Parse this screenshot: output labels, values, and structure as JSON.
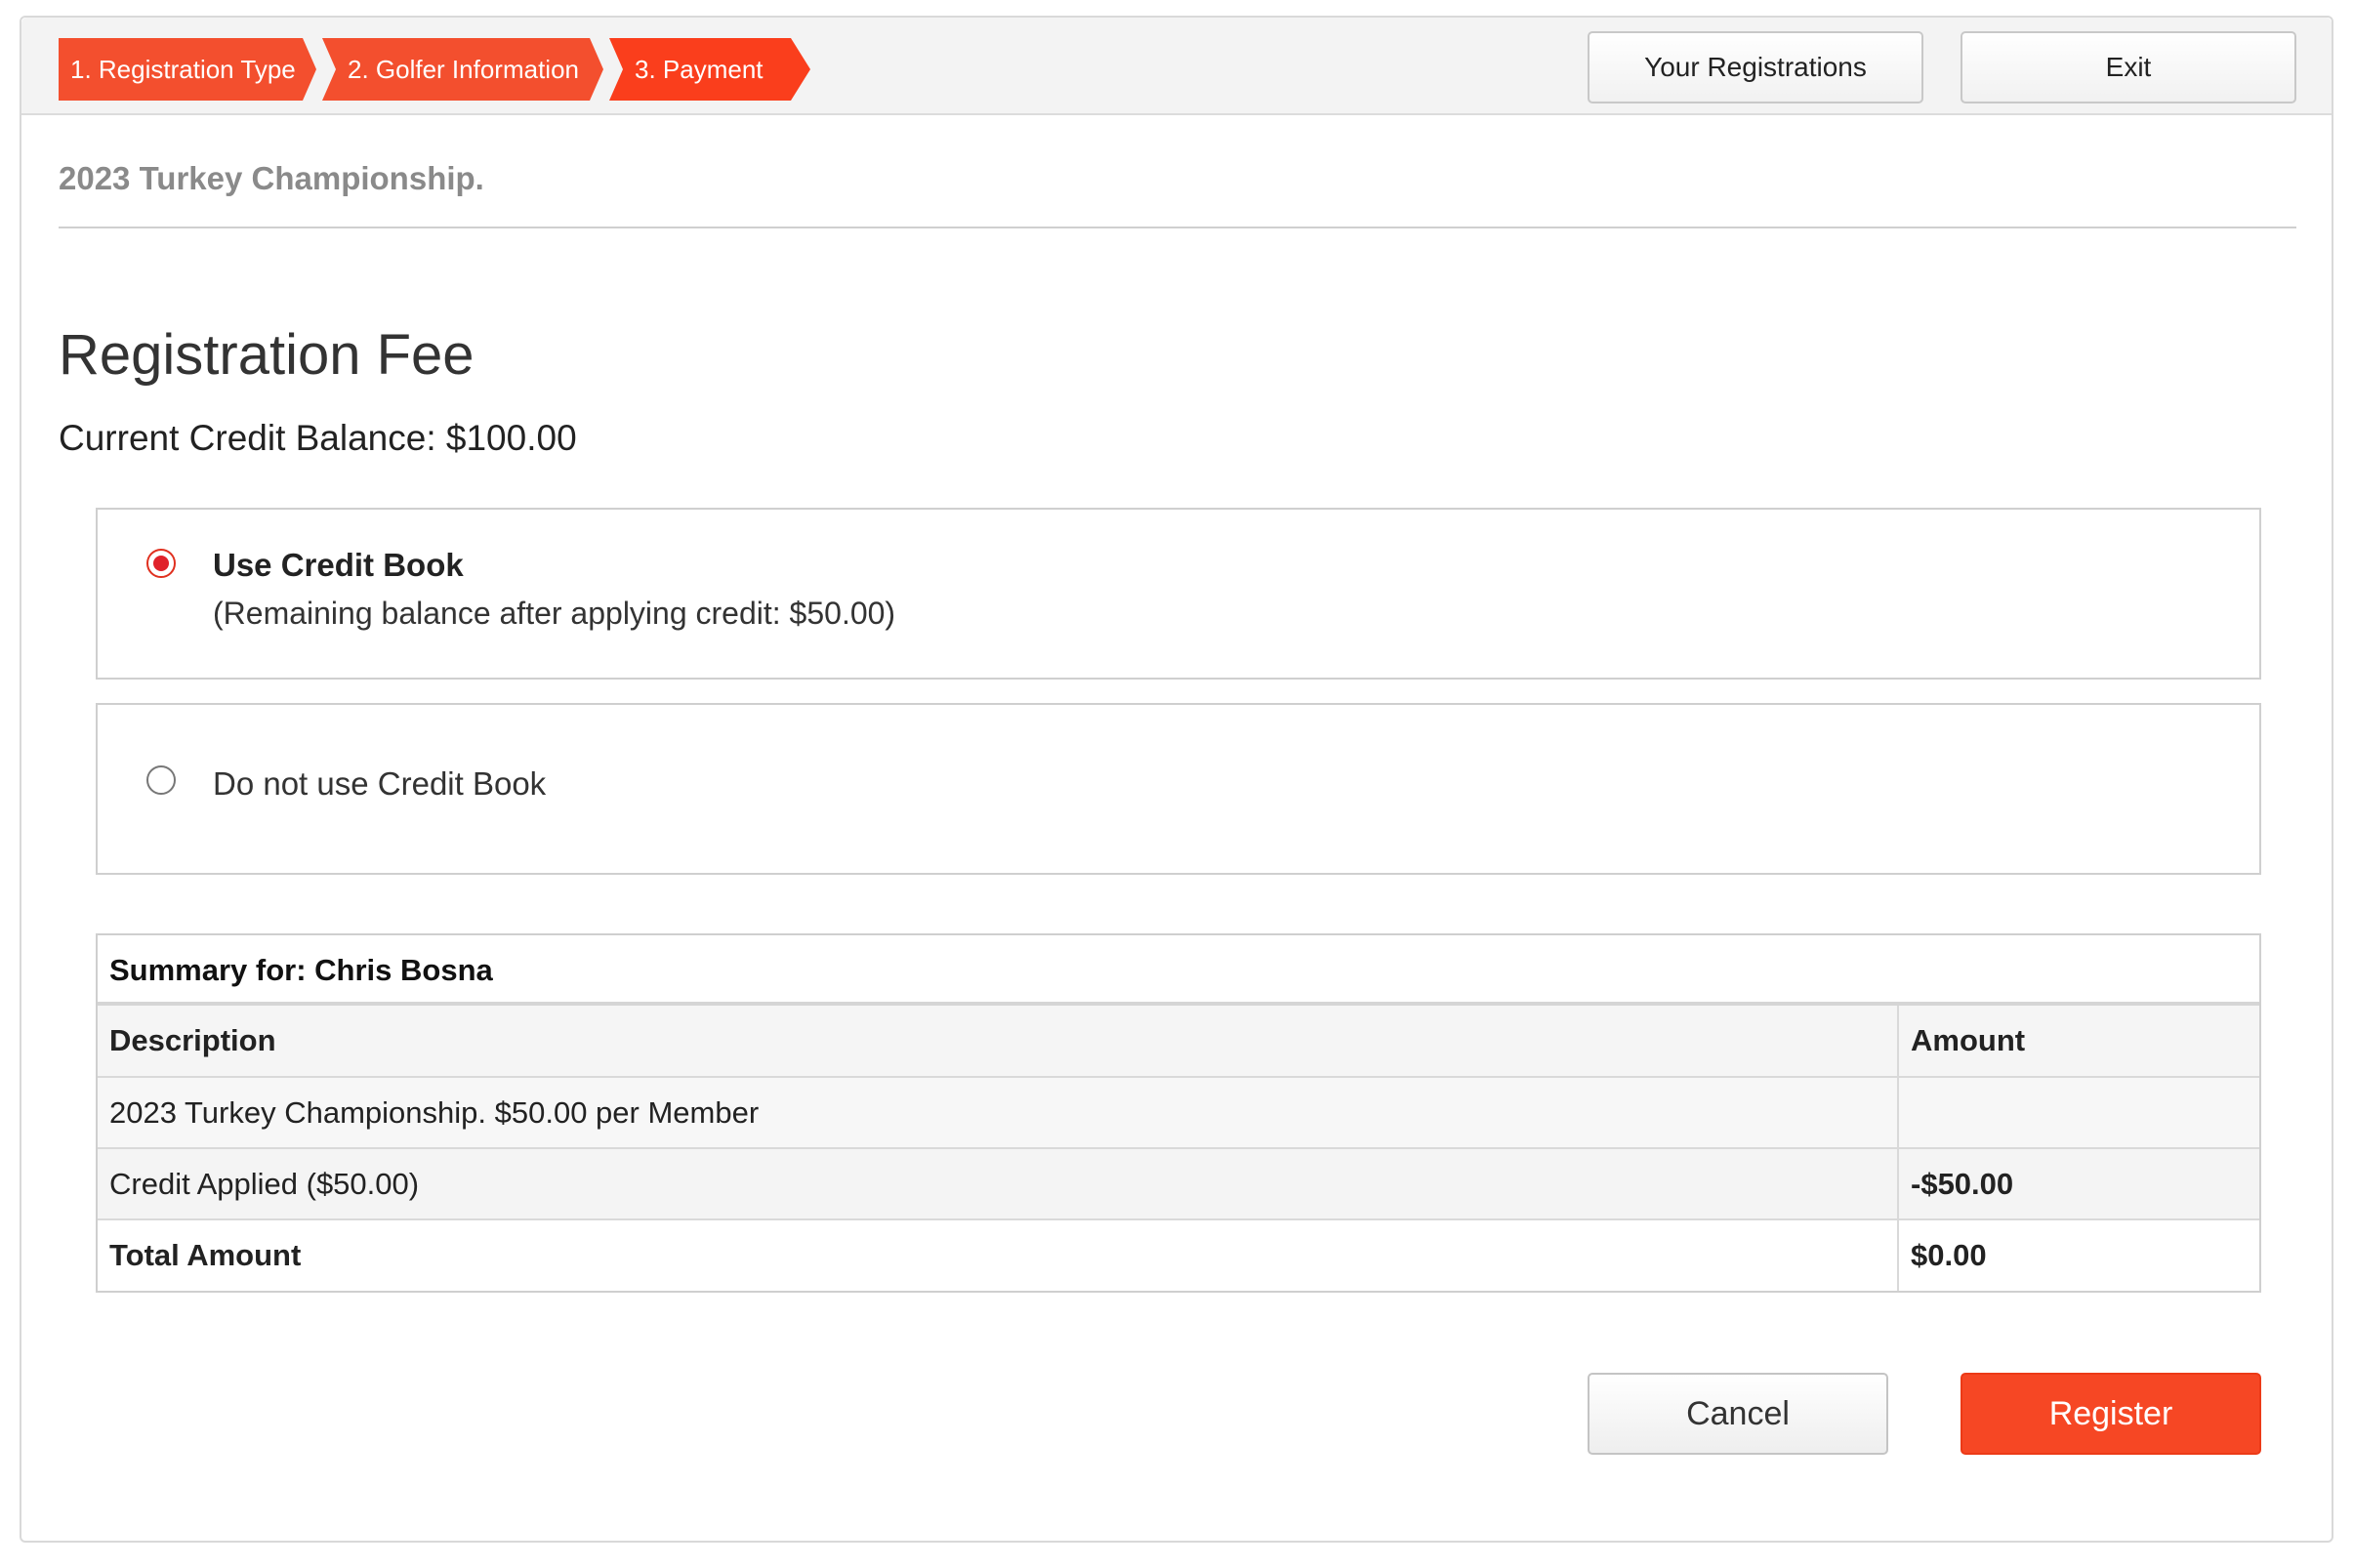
{
  "steps": [
    {
      "label": "1. Registration Type"
    },
    {
      "label": "2. Golfer Information"
    },
    {
      "label": "3. Payment"
    }
  ],
  "header": {
    "your_registrations_label": "Your Registrations",
    "exit_label": "Exit"
  },
  "event": {
    "title": "2023 Turkey Championship."
  },
  "fee": {
    "heading": "Registration Fee",
    "balance_text": "Current Credit Balance: $100.00"
  },
  "options": {
    "use_credit": {
      "title": "Use Credit Book",
      "subtitle": "(Remaining balance after applying credit: $50.00)",
      "selected": true
    },
    "no_credit": {
      "label": "Do not use Credit Book",
      "selected": false
    }
  },
  "summary": {
    "title": "Summary for: Chris Bosna",
    "columns": {
      "description": "Description",
      "amount": "Amount"
    },
    "rows": [
      {
        "description": "2023 Turkey Championship. $50.00 per Member",
        "amount": ""
      },
      {
        "description": "Credit Applied ($50.00)",
        "amount": "-$50.00"
      },
      {
        "description": "Total Amount",
        "amount": "$0.00"
      }
    ]
  },
  "actions": {
    "cancel_label": "Cancel",
    "register_label": "Register"
  },
  "colors": {
    "accent": "#f34f2e",
    "register": "#f64724",
    "radio_selected": "#e0222b"
  }
}
